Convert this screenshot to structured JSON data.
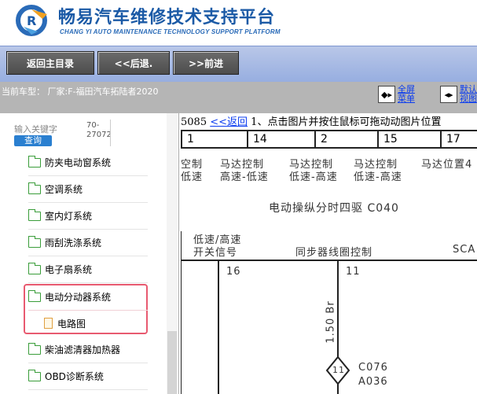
{
  "header": {
    "title_cn": "畅易汽车维修技术支持平台",
    "title_en": "CHANG YI AUTO MAINTENANCE TECHNOLOGY SUPPORT PLATFORM",
    "brand_color": "#1b5aa6"
  },
  "toolbar": {
    "home_label": "返回主目录",
    "back_label": "<<后退.",
    "forward_label": ">>前进"
  },
  "infobar": {
    "car_model": "当前车型： 厂家:F-福田汽车拓陆者2020",
    "fullscreen_label_1": "全屏",
    "fullscreen_label_2": "菜单",
    "view_label_1": "默认",
    "view_label_2": "视图"
  },
  "sidebar": {
    "search_label": "输入关键字",
    "search_button": "查询",
    "code_1": "70-",
    "code_2": "27072",
    "items": [
      {
        "label": "防夹电动窗系统"
      },
      {
        "label": "空调系统"
      },
      {
        "label": "室内灯系统"
      },
      {
        "label": "雨刮洗涤系统"
      },
      {
        "label": "电子扇系统"
      },
      {
        "label": "电动分动器系统"
      },
      {
        "label": "电路图"
      },
      {
        "label": "柴油滤清器加热器"
      },
      {
        "label": "OBD诊断系统"
      }
    ]
  },
  "diagram": {
    "page_id": "5085",
    "back_link": "<<返回",
    "instruction": "1、点击图片并按住鼠标可拖动动图片位置",
    "pins": [
      "1",
      "14",
      "2",
      "15",
      "17"
    ],
    "labels": {
      "l1a": "空制",
      "l1b": "低速",
      "l2a": "马达控制",
      "l2b": "高速-低速",
      "l3a": "马达控制",
      "l3b": "低速-高速",
      "l4a": "马达控制",
      "l4b": "低速-高速",
      "l5": "马达位置4",
      "module": "电动操纵分时四驱  C040",
      "sw_a": "低速/高速",
      "sw_b": "开关信号",
      "sync": "同步器线圈控制",
      "sca": "SCA",
      "wire_a": "16",
      "wire_b": "11",
      "wire_spec": "1.50 Br",
      "conn_num": "11",
      "conn_a": "C076",
      "conn_b": "A036"
    }
  }
}
